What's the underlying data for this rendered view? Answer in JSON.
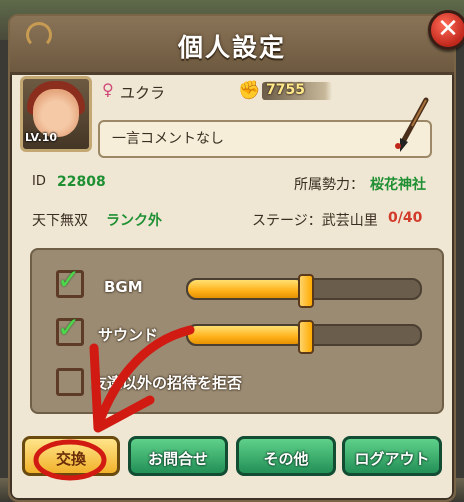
{
  "dialog": {
    "title": "個人設定",
    "close_label": "✕"
  },
  "profile": {
    "level": "LV.10",
    "name": "ユクラ",
    "power": "7755",
    "comment": "一言コメントなし",
    "id_label": "ID",
    "id_value": "22808",
    "faction_label": "所属勢力：",
    "faction_value": "桜花神社",
    "rank_label": "天下無双",
    "rank_value": "ランク外",
    "stage_label": "ステージ：武芸山里",
    "stage_value": "0/40"
  },
  "settings": {
    "bgm": {
      "label": "BGM",
      "checked": true,
      "level": 0.5
    },
    "sound": {
      "label": "サウンド",
      "checked": true,
      "level": 0.5
    },
    "invite": {
      "label": "友達以外の招待を拒否",
      "checked": false
    }
  },
  "tabs": [
    {
      "label": "交換",
      "active": true
    },
    {
      "label": "お問合せ",
      "active": false
    },
    {
      "label": "その他",
      "active": false
    },
    {
      "label": "ログアウト",
      "active": false
    }
  ],
  "colors": {
    "accent_green": "#1f8f33",
    "stage_red": "#d23a2a",
    "annotation_red": "#d11b12"
  }
}
